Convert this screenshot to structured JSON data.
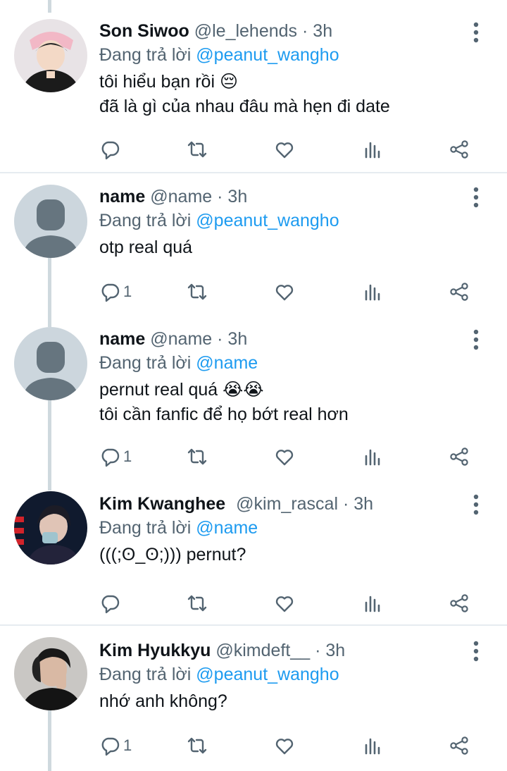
{
  "tweets": [
    {
      "name": "Son Siwoo",
      "handle": "@le_lehends",
      "time": "3h",
      "reply_prefix": "Đang trả lời",
      "reply_to": "@peanut_wangho",
      "lines": [
        "tôi hiểu bạn rồi 😔",
        "đã là gì của nhau đâu mà hẹn đi date"
      ],
      "reply_count": "",
      "avatar": "photo"
    },
    {
      "name": "name",
      "handle": "@name",
      "time": "3h",
      "reply_prefix": "Đang trả lời",
      "reply_to": "@peanut_wangho",
      "lines": [
        "otp real quá"
      ],
      "reply_count": "1",
      "avatar": "default"
    },
    {
      "name": "name",
      "handle": "@name",
      "time": "3h",
      "reply_prefix": "Đang trả lời",
      "reply_to": "@name",
      "lines": [
        "pernut real quá 😭😭",
        "tôi cần fanfic để họ bớt real hơn"
      ],
      "reply_count": "1",
      "avatar": "default"
    },
    {
      "name": "Kim Kwanghee",
      "handle": "@kim_rascal",
      "time": "3h",
      "reply_prefix": "Đang trả lời",
      "reply_to": "@name",
      "lines": [
        "(((;ʘ_ʘ;))) pernut?"
      ],
      "reply_count": "",
      "avatar": "photo"
    },
    {
      "name": "Kim Hyukkyu",
      "handle": "@kimdeft__",
      "time": "3h",
      "reply_prefix": "Đang trả lời",
      "reply_to": "@peanut_wangho",
      "lines": [
        "nhớ anh không?"
      ],
      "reply_count": "1",
      "avatar": "photo"
    }
  ],
  "colors": {
    "mention": "#1d9bf0",
    "secondary_text": "#536471",
    "thread_line": "#cfd9de",
    "default_avatar_bg": "#ccd6dd",
    "default_avatar_fg": "#66757f"
  },
  "icons": [
    "reply-icon",
    "retweet-icon",
    "like-icon",
    "analytics-icon",
    "share-icon",
    "more-icon"
  ]
}
